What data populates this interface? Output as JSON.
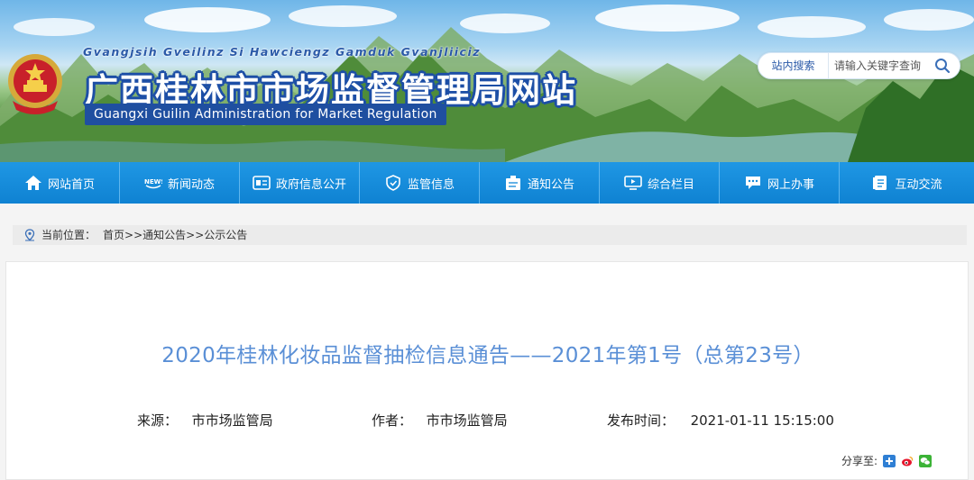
{
  "header": {
    "zhuang_name": "Gvangjsih Gveilinz Si Hawciengz Gamduk Gvanjliiciz",
    "title": "广西桂林市市场监督管理局网站",
    "subtitle": "Guangxi Guilin Administration for Market Regulation",
    "search": {
      "label": "站内搜索",
      "placeholder": "请输入关键字查询"
    }
  },
  "nav": {
    "items": [
      {
        "label": "网站首页",
        "icon": "home-icon"
      },
      {
        "label": "新闻动态",
        "icon": "news-icon"
      },
      {
        "label": "政府信息公开",
        "icon": "info-disclosure-icon"
      },
      {
        "label": "监管信息",
        "icon": "shield-icon"
      },
      {
        "label": "通知公告",
        "icon": "announcement-icon"
      },
      {
        "label": "综合栏目",
        "icon": "monitor-icon"
      },
      {
        "label": "网上办事",
        "icon": "chat-service-icon"
      },
      {
        "label": "互动交流",
        "icon": "document-icon"
      }
    ]
  },
  "breadcrumb": {
    "prefix": "当前位置：",
    "items": [
      "首页",
      "通知公告",
      "公示公告"
    ],
    "separator": ">>"
  },
  "article": {
    "title": "2020年桂林化妆品监督抽检信息通告——2021年第1号（总第23号）",
    "source_label": "来源：",
    "source_value": "市市场监管局",
    "author_label": "作者：",
    "author_value": "市市场监管局",
    "date_label": "发布时间：",
    "date_value": "2021-01-11 15:15:00",
    "share_label": "分享至:"
  },
  "colors": {
    "nav_bg": "#1289d8",
    "title_blue": "#5a8fd6",
    "brand_dark_blue": "#1f4fa0"
  }
}
